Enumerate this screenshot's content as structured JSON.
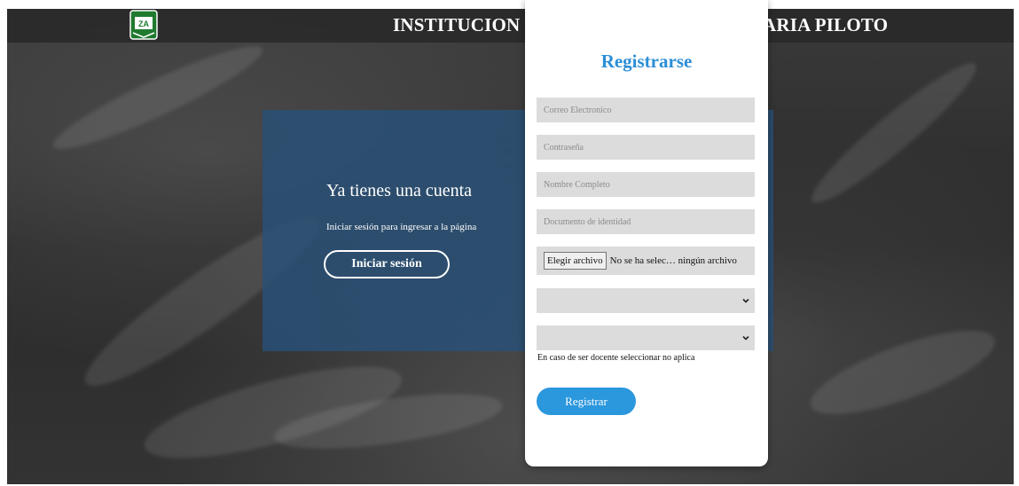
{
  "header": {
    "title_left": "INSTITUCION",
    "title_right": "ARIA PILOTO",
    "logo_icon": "school-shield-logo"
  },
  "login_panel": {
    "heading": "Ya tienes una cuenta",
    "subtitle": "Iniciar sesión para ingresar a la página",
    "button_label": "Iniciar sesión"
  },
  "register_form": {
    "title": "Registrarse",
    "email_placeholder": "Correo Electronico",
    "password_placeholder": "Contraseña",
    "fullname_placeholder": "Nombre Completo",
    "document_placeholder": "Documento de identidad",
    "file_button_label": "Elegir archivo",
    "file_status": "No se ha selec… ningún archivo",
    "select_1_value": "",
    "select_2_value": "",
    "note": "En caso de ser docente seleccionar no aplica",
    "submit_label": "Registrar"
  },
  "colors": {
    "accent_blue": "#2b8ed6",
    "button_blue": "#2b97dd",
    "panel_blue": "#28507a",
    "field_gray": "#dcdcdc"
  }
}
